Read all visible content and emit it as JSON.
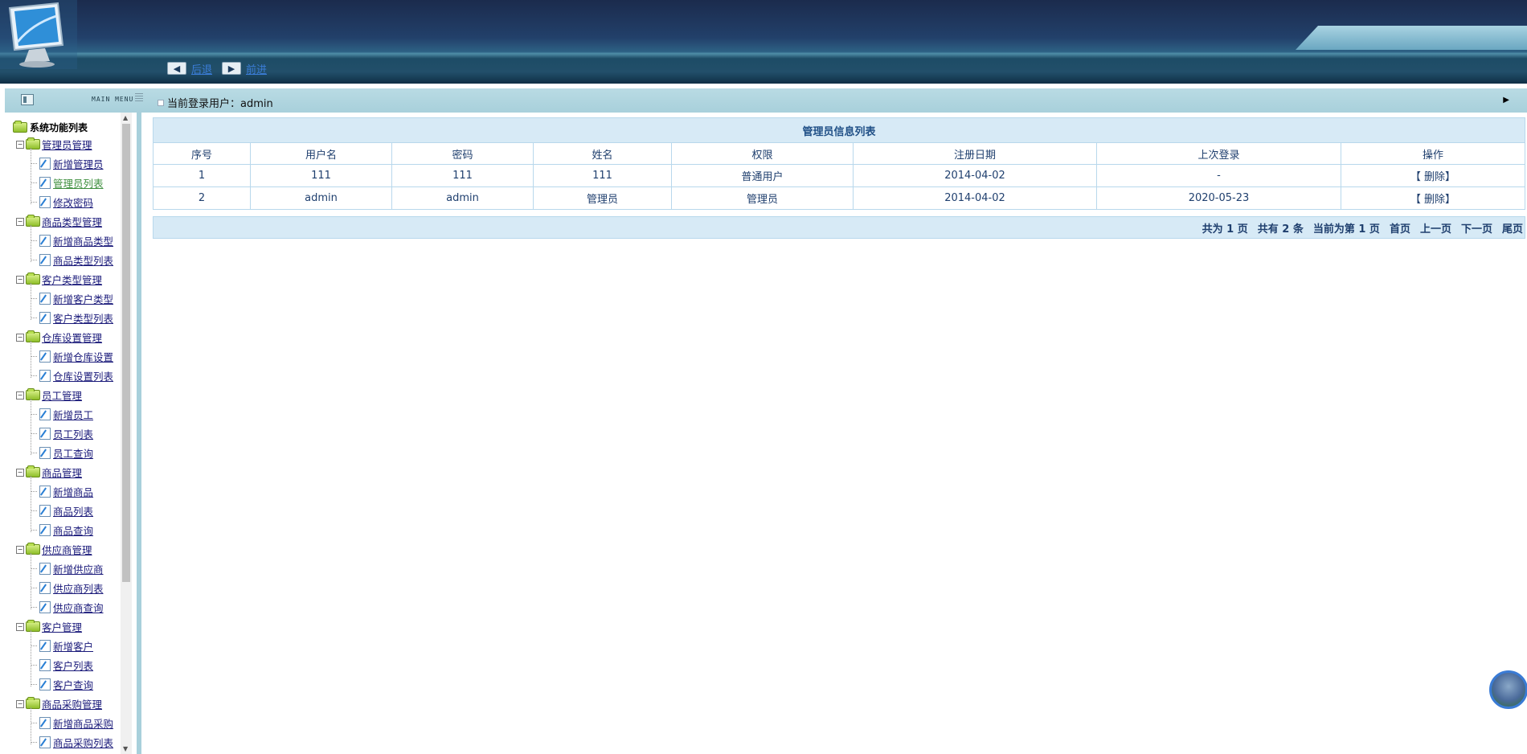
{
  "nav": {
    "back_label": "后退",
    "forward_label": "前进"
  },
  "menu_header": {
    "label": "MAIN MENU"
  },
  "user_bar": {
    "text": "当前登录用户：admin"
  },
  "tree": {
    "root_label": "系统功能列表",
    "groups": [
      {
        "label": "管理员管理",
        "items": [
          "新增管理员",
          "管理员列表",
          "修改密码"
        ]
      },
      {
        "label": "商品类型管理",
        "items": [
          "新增商品类型",
          "商品类型列表"
        ]
      },
      {
        "label": "客户类型管理",
        "items": [
          "新增客户类型",
          "客户类型列表"
        ]
      },
      {
        "label": "仓库设置管理",
        "items": [
          "新增仓库设置",
          "仓库设置列表"
        ]
      },
      {
        "label": "员工管理",
        "items": [
          "新增员工",
          "员工列表",
          "员工查询"
        ]
      },
      {
        "label": "商品管理",
        "items": [
          "新增商品",
          "商品列表",
          "商品查询"
        ]
      },
      {
        "label": "供应商管理",
        "items": [
          "新增供应商",
          "供应商列表",
          "供应商查询"
        ]
      },
      {
        "label": "客户管理",
        "items": [
          "新增客户",
          "客户列表",
          "客户查询"
        ]
      },
      {
        "label": "商品采购管理",
        "items": [
          "新增商品采购",
          "商品采购列表"
        ]
      }
    ]
  },
  "table": {
    "title": "管理员信息列表",
    "columns": [
      "序号",
      "用户名",
      "密码",
      "姓名",
      "权限",
      "注册日期",
      "上次登录",
      "操作"
    ],
    "rows": [
      [
        "1",
        "111",
        "111",
        "111",
        "普通用户",
        "2014-04-02",
        "-",
        "【 删除】"
      ],
      [
        "2",
        "admin",
        "admin",
        "管理员",
        "管理员",
        "2014-04-02",
        "2020-05-23",
        "【 删除】"
      ]
    ]
  },
  "pager": {
    "total_pages": "共为 1 页",
    "total_records": "共有 2 条",
    "current_page": "当前为第 1 页",
    "first": "首页",
    "prev": "上一页",
    "next": "下一页",
    "last": "尾页"
  },
  "colors": {
    "header_dark": "#1b2b4d",
    "strip": "#a8d0db",
    "table_head": "#d7eaf6",
    "table_border": "#b8d8ec",
    "link": "#1a1a7a",
    "active_link": "#3e8f3e"
  },
  "icons": [
    "monitor-logo-icon",
    "back-arrow-icon",
    "forward-arrow-icon",
    "menu-toggle-icon",
    "folder-icon",
    "document-edit-icon",
    "collapse-arrow-icon",
    "avatar-icon"
  ]
}
